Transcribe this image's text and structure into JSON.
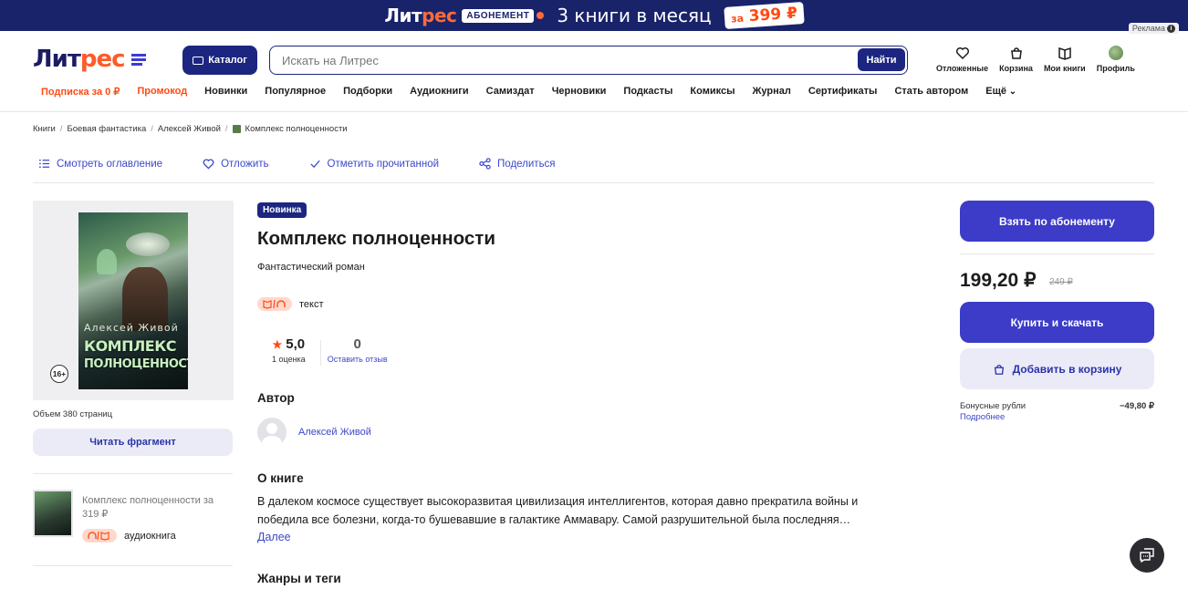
{
  "promo": {
    "logo_main": "Лит",
    "logo_accent": "рес",
    "abonement": "АБОНЕМЕНТ",
    "message": "3 книги в месяц",
    "price_prefix": "за",
    "price": "399 ₽",
    "ad_label": "Реклама"
  },
  "header": {
    "logo_main": "Лит",
    "logo_accent": "рес",
    "catalog": "Каталог",
    "search_placeholder": "Искать на Литрес",
    "search_button": "Найти",
    "icons": {
      "wishlist": "Отложенные",
      "cart": "Корзина",
      "my_books": "Мои книги",
      "profile": "Профиль"
    }
  },
  "nav": {
    "subscription": "Подписка за 0 ₽",
    "promo_code": "Промокод",
    "items": [
      "Новинки",
      "Популярное",
      "Подборки",
      "Аудиокниги",
      "Самиздат",
      "Черновики",
      "Подкасты",
      "Комиксы",
      "Журнал",
      "Сертификаты",
      "Стать автором"
    ],
    "more": "Ещё"
  },
  "breadcrumb": [
    "Книги",
    "Боевая фантастика",
    "Алексей Живой",
    "Комплекс полноценности"
  ],
  "actions": {
    "contents": "Смотреть оглавление",
    "defer": "Отложить",
    "mark_read": "Отметить прочитанной",
    "share": "Поделиться"
  },
  "book": {
    "badge": "Новинка",
    "title": "Комплекс полноценности",
    "genre": "Фантастический роман",
    "format_label": "текст",
    "rating": "5,0",
    "rating_count": "1 оценка",
    "reviews": "0",
    "leave_review": "Оставить отзыв",
    "author_heading": "Автор",
    "author": "Алексей Живой",
    "about_heading": "О книге",
    "about": "В далеком космосе существует высокоразвитая цивилизация интеллигентов, которая давно прекратила войны и победила все болезни, когда-то бушевавшие в галактике Аммавару. Самой разрушительной была последняя…",
    "more": "Далее",
    "genres_heading": "Жанры и теги",
    "age": "16+",
    "volume": "Объем 380 страниц",
    "read_fragment": "Читать фрагмент",
    "cover_author": "Алексей Живой",
    "cover_title_1": "КОМПЛЕКС",
    "cover_title_2": "ПОЛНОЦЕННОСТИ"
  },
  "alt_edition": {
    "title": "Комплекс полноценности за 319 ₽",
    "format": "аудиокнига"
  },
  "purchase": {
    "subscribe": "Взять по абонементу",
    "price": "199,20 ₽",
    "old_price": "249 ₽",
    "buy": "Купить и скачать",
    "add_to_cart": "Добавить в корзину",
    "bonus_label": "Бонусные рубли",
    "bonus_value": "−49,80 ₽",
    "bonus_more": "Подробнее"
  },
  "colors": {
    "brand_dark": "#1c2680",
    "brand_primary": "#3c3cc8",
    "accent_orange": "#ff4a12"
  }
}
